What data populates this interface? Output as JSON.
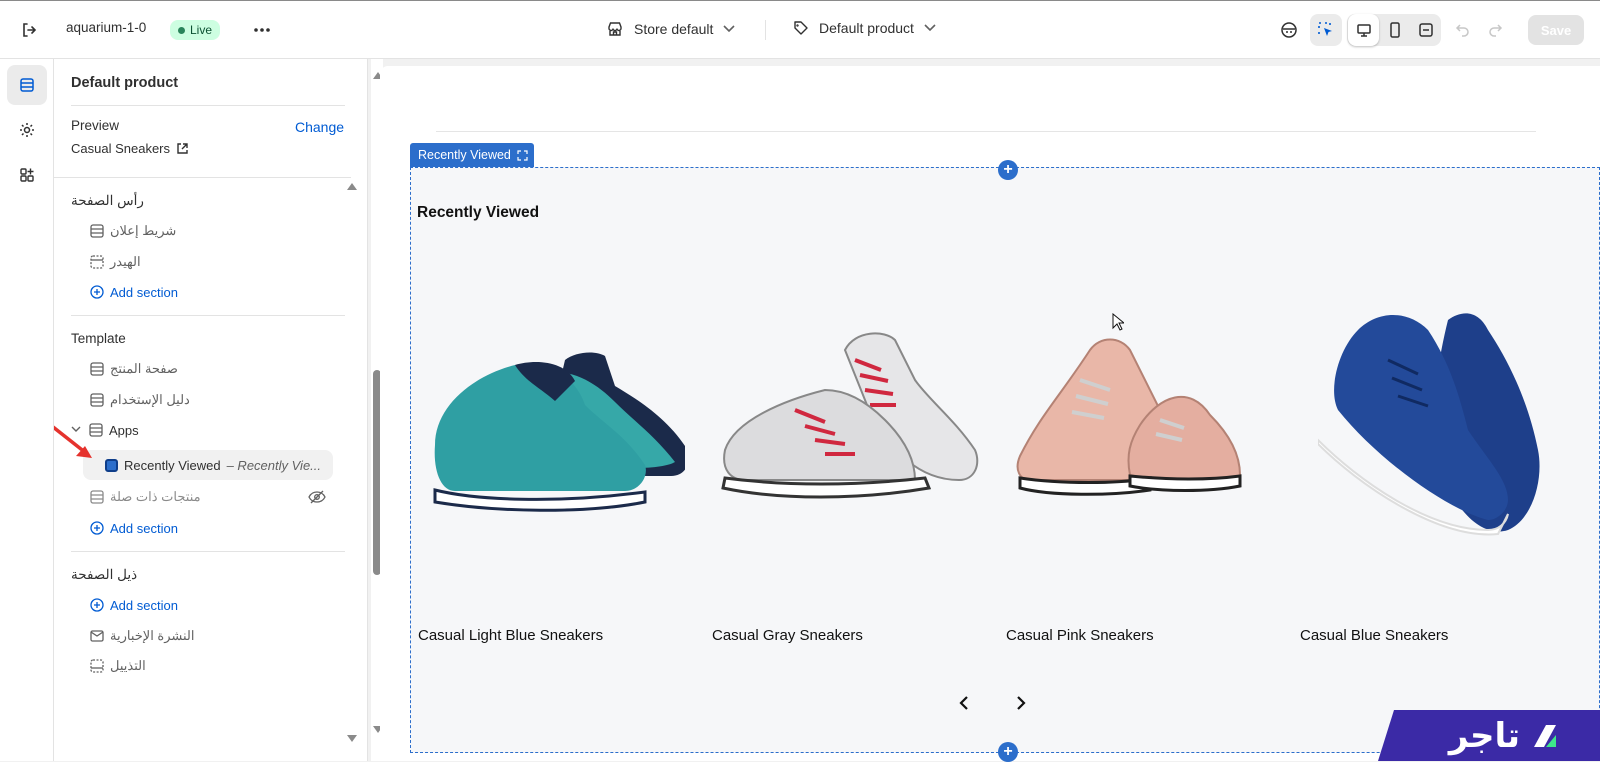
{
  "topbar": {
    "store_name": "aquarium-1-0",
    "live_badge": "Live",
    "store_selector": "Store default",
    "template_selector": "Default product",
    "save_label": "Save"
  },
  "panel": {
    "title": "Default product",
    "preview_label": "Preview",
    "change_link": "Change",
    "preview_product": "Casual Sneakers",
    "header_group": "رأس الصفحة",
    "header_items": [
      "شريط إعلان",
      "الهيدر"
    ],
    "add_section": "Add section",
    "template_group": "Template",
    "template_items": [
      "صفحة المنتج",
      "دليل الإستخدام"
    ],
    "apps_label": "Apps",
    "app_block_name": "Recently Viewed",
    "app_block_sub": "– Recently Vie...",
    "hidden_item": "منتجات ذات صلة",
    "footer_group": "ذيل الصفحة",
    "footer_items": [
      "النشرة الإخبارية",
      "التذييل"
    ]
  },
  "preview": {
    "section_tag": "Recently Viewed",
    "section_heading": "Recently Viewed",
    "products": [
      {
        "name": "Casual Light Blue Sneakers"
      },
      {
        "name": "Casual Gray Sneakers"
      },
      {
        "name": "Casual Pink Sneakers"
      },
      {
        "name": "Casual Blue Sneakers"
      }
    ]
  },
  "brand": {
    "logo_text": "تاجر"
  },
  "colors": {
    "accent": "#2c6ecb",
    "brand": "#3b2aa6",
    "live": "#cdfee1"
  }
}
